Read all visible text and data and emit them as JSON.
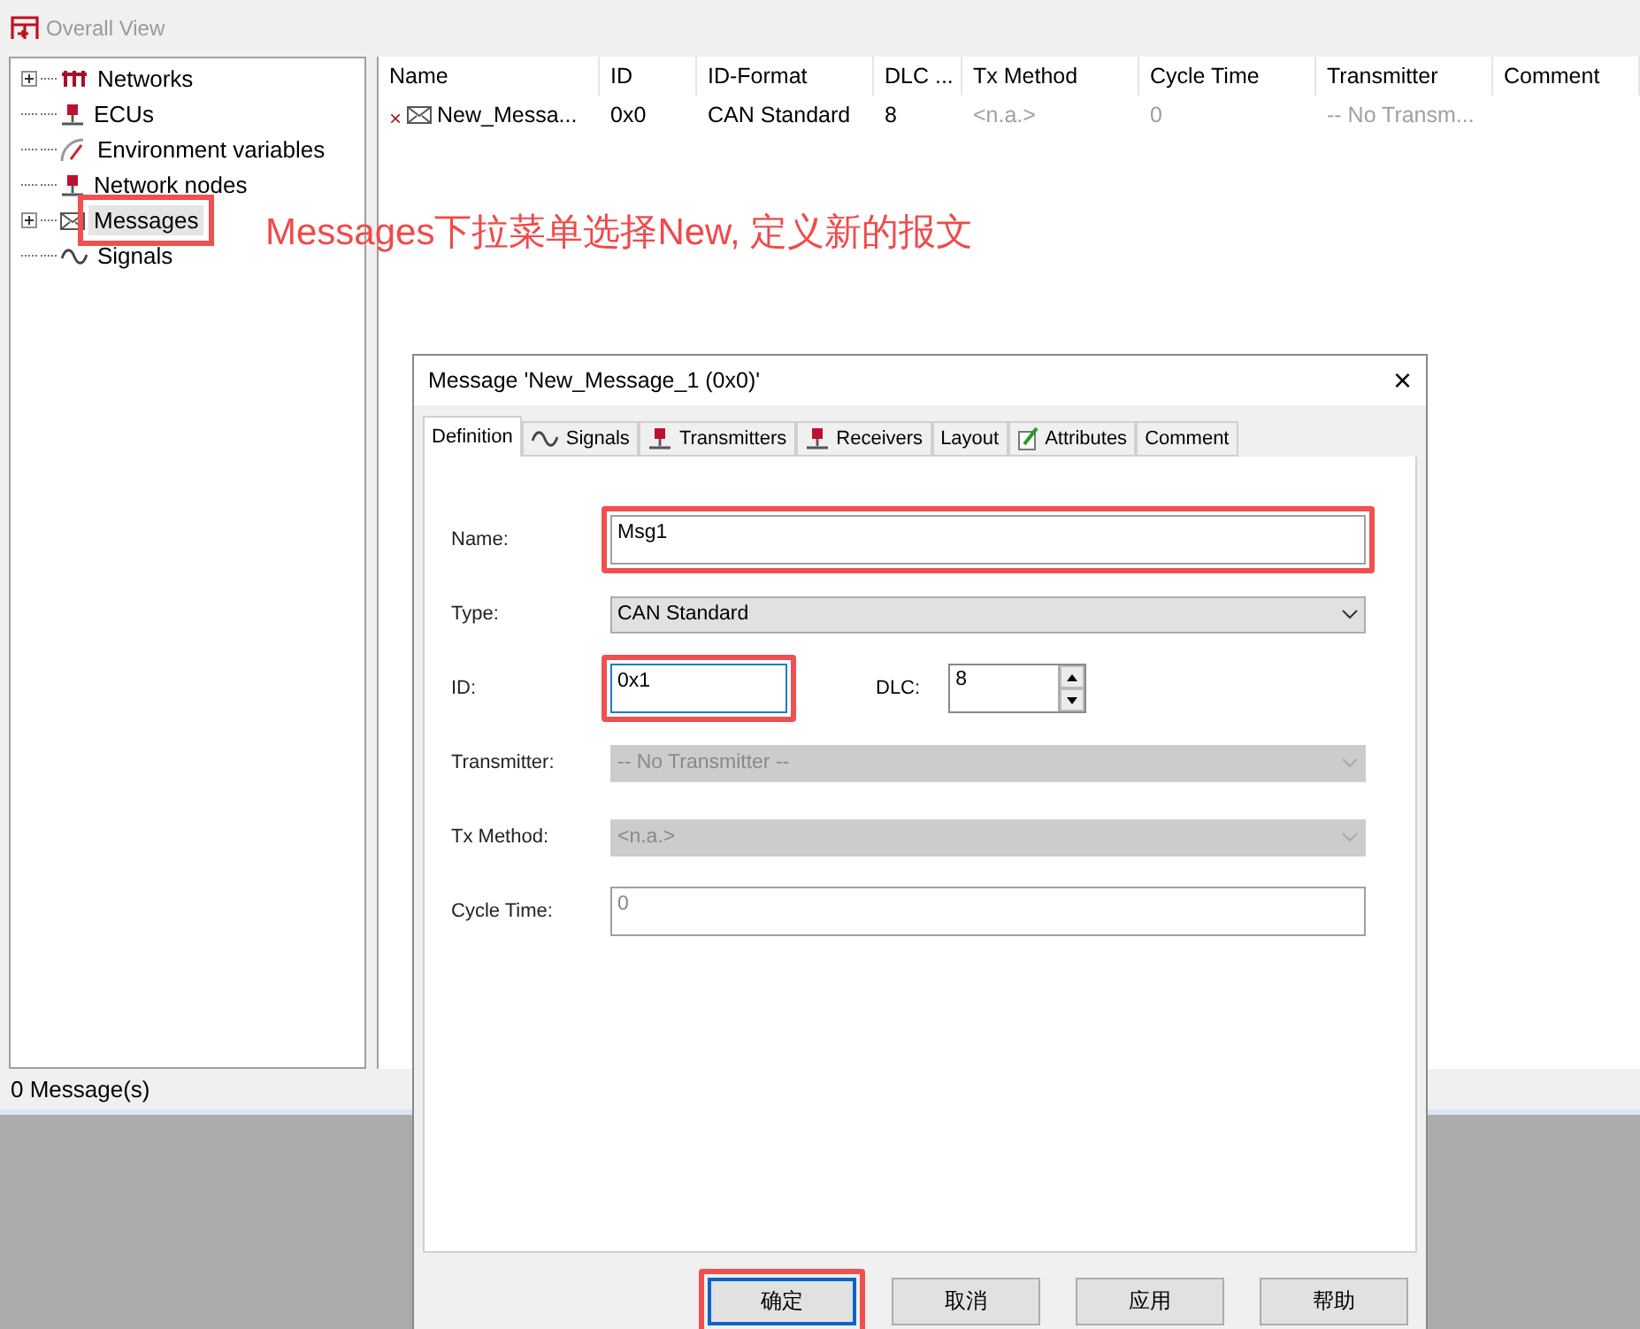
{
  "window": {
    "title": "Overall View"
  },
  "tree": {
    "items": [
      {
        "label": "Networks",
        "kind": "network",
        "expandable": true,
        "selected": false
      },
      {
        "label": "ECUs",
        "kind": "node",
        "expandable": false,
        "selected": false
      },
      {
        "label": "Environment variables",
        "kind": "gauge",
        "expandable": false,
        "selected": false
      },
      {
        "label": "Network nodes",
        "kind": "node",
        "expandable": false,
        "selected": false
      },
      {
        "label": "Messages",
        "kind": "envelope",
        "expandable": true,
        "selected": true
      },
      {
        "label": "Signals",
        "kind": "wave",
        "expandable": false,
        "selected": false
      }
    ]
  },
  "table": {
    "columns": [
      "Name",
      "ID",
      "ID-Format",
      "DLC ...",
      "Tx Method",
      "Cycle Time",
      "Transmitter",
      "Comment"
    ],
    "rows": [
      {
        "mark": "×",
        "cells": [
          {
            "text": "New_Messa...",
            "dimmed": false
          },
          {
            "text": "0x0",
            "dimmed": false
          },
          {
            "text": "CAN Standard",
            "dimmed": false
          },
          {
            "text": "8",
            "dimmed": false
          },
          {
            "text": "<n.a.>",
            "dimmed": true
          },
          {
            "text": "0",
            "dimmed": true
          },
          {
            "text": "-- No Transm...",
            "dimmed": true
          }
        ]
      }
    ]
  },
  "status_bar": "0 Message(s)",
  "annotation": {
    "text": "Messages下拉菜单选择New, 定义新的报文"
  },
  "dialog": {
    "title": "Message 'New_Message_1 (0x0)'",
    "close": "×",
    "tabs": [
      {
        "label": "Definition",
        "kind": "plain",
        "selected": true
      },
      {
        "label": "Signals",
        "kind": "wave",
        "selected": false
      },
      {
        "label": "Transmitters",
        "kind": "node",
        "selected": false
      },
      {
        "label": "Receivers",
        "kind": "node",
        "selected": false
      },
      {
        "label": "Layout",
        "kind": "plain",
        "selected": false
      },
      {
        "label": "Attributes",
        "kind": "pencil",
        "selected": false
      },
      {
        "label": "Comment",
        "kind": "plain",
        "selected": false
      }
    ],
    "fields": [
      {
        "label": "Name:",
        "kind": "text",
        "value": "Msg1",
        "disabled": false,
        "focused": false,
        "highlighted": true
      },
      {
        "label": "Type:",
        "kind": "select",
        "value": "CAN Standard",
        "disabled": false,
        "focused": false,
        "highlighted": false
      },
      {
        "label": "ID:",
        "kind": "id",
        "value": "0x1",
        "disabled": false,
        "focused": true,
        "highlighted": true,
        "dlc_label": "DLC:",
        "dlc_value": "8"
      },
      {
        "label": "Transmitter:",
        "kind": "select",
        "value": "-- No Transmitter --",
        "disabled": true,
        "focused": false,
        "highlighted": false
      },
      {
        "label": "Tx Method:",
        "kind": "select",
        "value": "<n.a.>",
        "disabled": true,
        "focused": false,
        "highlighted": false
      },
      {
        "label": "Cycle Time:",
        "kind": "text",
        "value": "0",
        "disabled": true,
        "focused": false,
        "highlighted": false
      }
    ],
    "buttons": [
      {
        "label": "确定",
        "default": true,
        "highlighted": true
      },
      {
        "label": "取消",
        "default": false,
        "highlighted": false
      },
      {
        "label": "应用",
        "default": false,
        "highlighted": false
      },
      {
        "label": "帮助",
        "default": false,
        "highlighted": false
      }
    ]
  }
}
